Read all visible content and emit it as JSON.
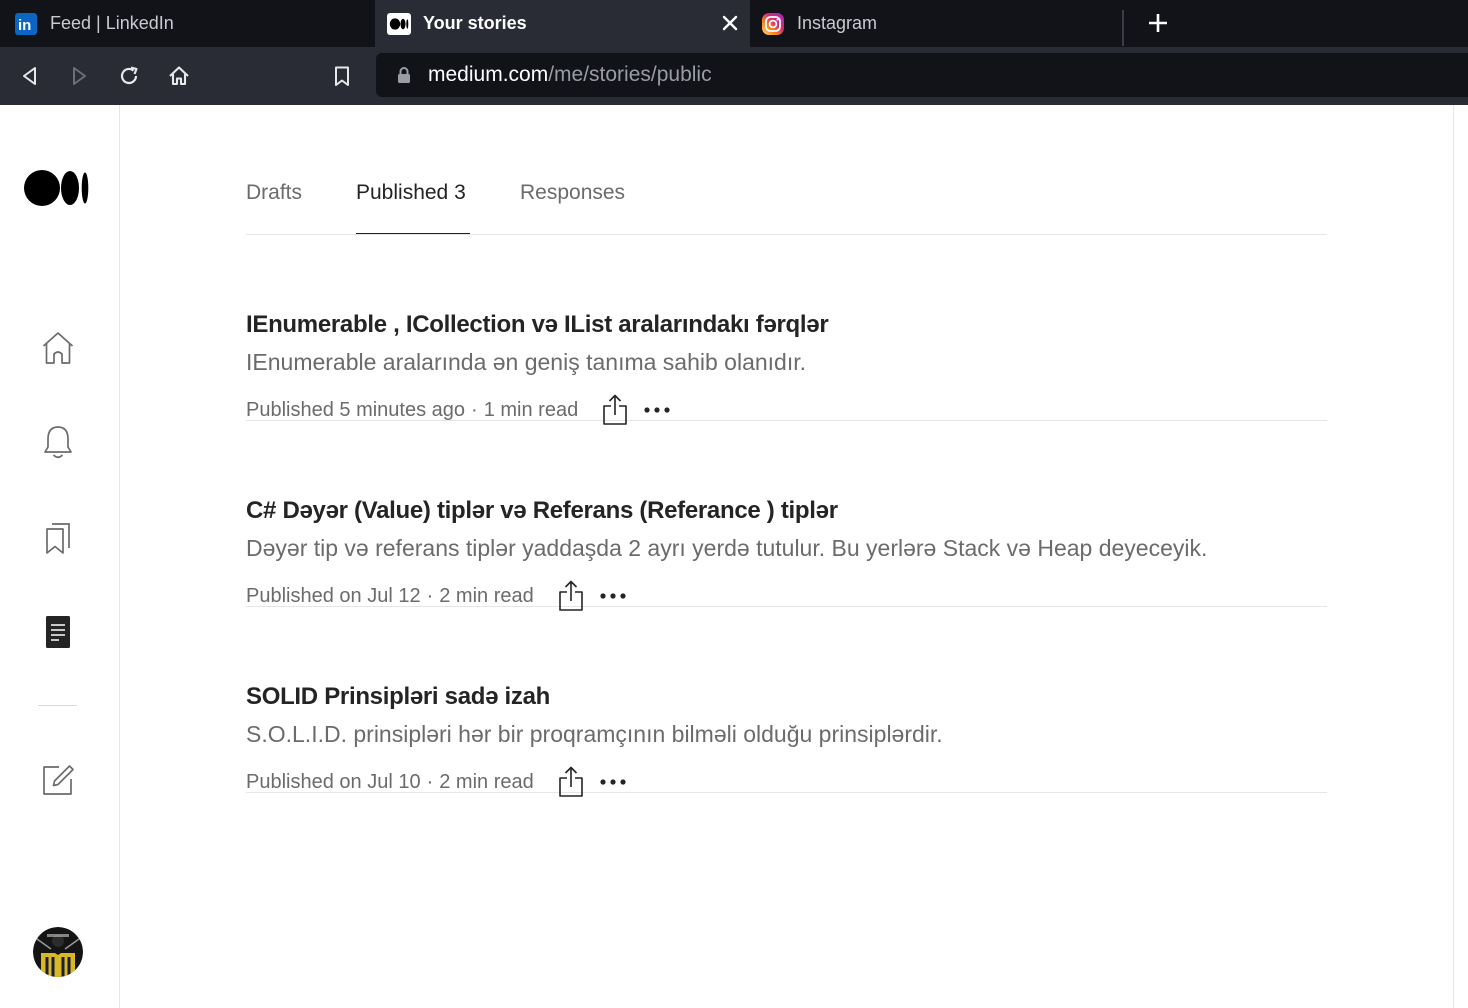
{
  "browser": {
    "tabs": [
      {
        "title": "Feed | LinkedIn",
        "icon": "linkedin-icon"
      },
      {
        "title": "Your stories",
        "icon": "medium-icon",
        "active": true
      },
      {
        "title": "Instagram",
        "icon": "instagram-icon"
      }
    ],
    "url": {
      "host": "medium.com",
      "path": "/me/stories/public"
    }
  },
  "sidebar": {
    "logo": "medium-logo",
    "items": [
      {
        "name": "home",
        "icon": "home-icon"
      },
      {
        "name": "notifications",
        "icon": "bell-icon"
      },
      {
        "name": "lists",
        "icon": "bookmarks-icon"
      },
      {
        "name": "stories",
        "icon": "document-icon",
        "active": true
      },
      {
        "name": "write",
        "icon": "write-icon"
      }
    ]
  },
  "tabs": {
    "drafts": "Drafts",
    "published": "Published 3",
    "responses": "Responses"
  },
  "stories": [
    {
      "title": "IEnumerable , ICollection və IList aralarındakı fərqlər",
      "subtitle": "IEnumerable aralarında ən geniş tanıma sahib olanıdır.",
      "published": "Published 5 minutes ago",
      "read_time": "1 min read"
    },
    {
      "title": "C# Dəyər (Value) tiplər və Referans (Referance ) tiplər",
      "subtitle": "Dəyər tip və referans tiplər yaddaşda 2 ayrı yerdə tutulur. Bu yerlərə Stack və Heap deyeceyik.",
      "published": "Published on Jul 12",
      "read_time": "2 min read"
    },
    {
      "title": "SOLID Prinsipləri sadə izah",
      "subtitle": "S.O.L.I.D. prinsipləri hər bir proqramçının bilməli olduğu prinsiplərdir.",
      "published": "Published on Jul 10",
      "read_time": "2 min read"
    }
  ],
  "separator": "·",
  "colors": {
    "accent": "#242424",
    "muted": "#6b6b6b",
    "chrome_dark": "#111319",
    "chrome": "#2a2c35"
  }
}
